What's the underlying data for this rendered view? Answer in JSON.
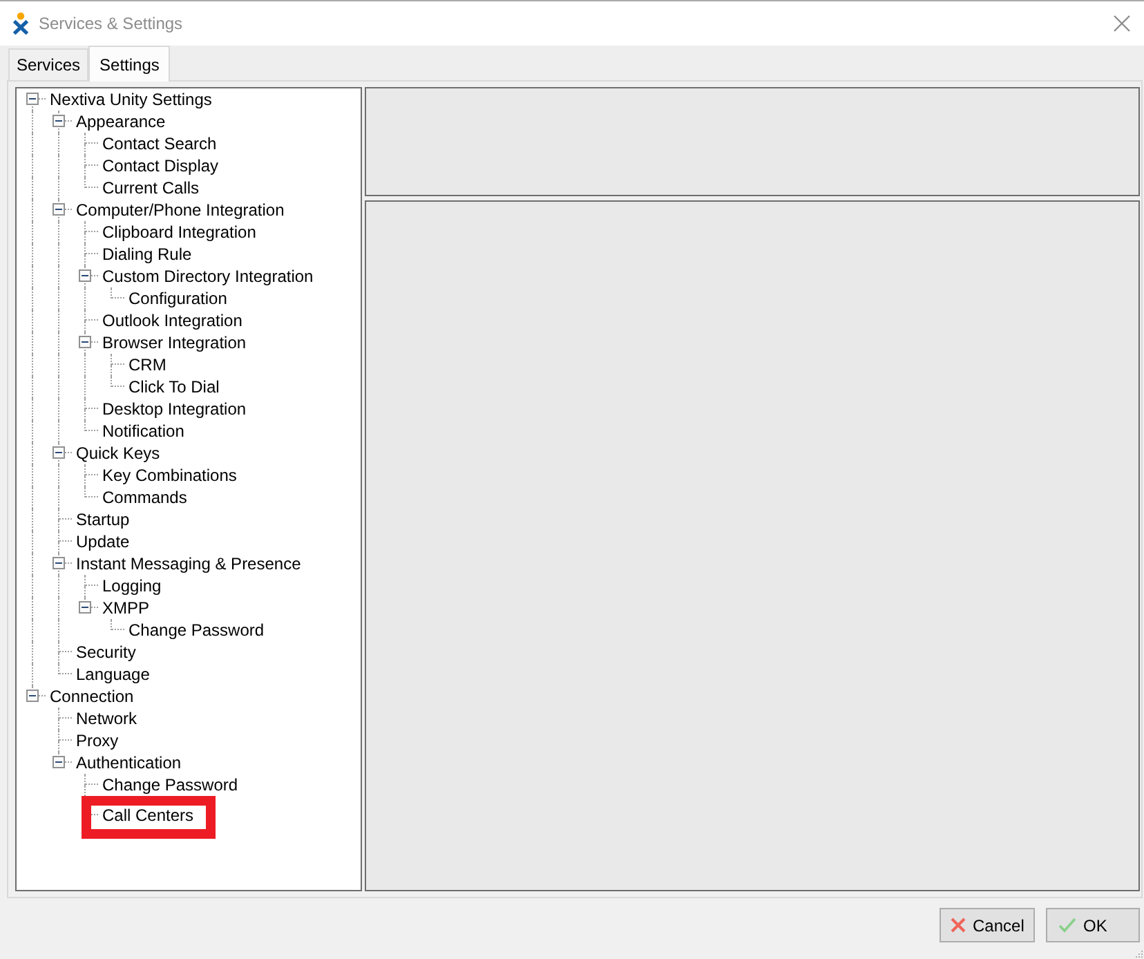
{
  "window": {
    "title": "Services & Settings"
  },
  "tabs": [
    {
      "label": "Services",
      "selected": false
    },
    {
      "label": "Settings",
      "selected": true
    }
  ],
  "settings_tree": [
    {
      "label": "Nextiva Unity Settings",
      "expanded": true,
      "highlighted": false,
      "children": [
        {
          "label": "Appearance",
          "expanded": true,
          "highlighted": false,
          "children": [
            {
              "label": "Contact Search",
              "highlighted": false
            },
            {
              "label": "Contact Display",
              "highlighted": false
            },
            {
              "label": "Current Calls",
              "highlighted": false
            }
          ]
        },
        {
          "label": "Computer/Phone Integration",
          "expanded": true,
          "highlighted": false,
          "children": [
            {
              "label": "Clipboard Integration",
              "highlighted": false
            },
            {
              "label": "Dialing Rule",
              "highlighted": false
            },
            {
              "label": "Custom Directory Integration",
              "expanded": true,
              "highlighted": false,
              "children": [
                {
                  "label": "Configuration",
                  "highlighted": false
                }
              ]
            },
            {
              "label": "Outlook Integration",
              "highlighted": false
            },
            {
              "label": "Browser Integration",
              "expanded": true,
              "highlighted": false,
              "children": [
                {
                  "label": "CRM",
                  "highlighted": false
                },
                {
                  "label": "Click To Dial",
                  "highlighted": false
                }
              ]
            },
            {
              "label": "Desktop Integration",
              "highlighted": false
            },
            {
              "label": "Notification",
              "highlighted": false
            }
          ]
        },
        {
          "label": "Quick Keys",
          "expanded": true,
          "highlighted": false,
          "children": [
            {
              "label": "Key Combinations",
              "highlighted": false
            },
            {
              "label": "Commands",
              "highlighted": false
            }
          ]
        },
        {
          "label": "Startup",
          "highlighted": false
        },
        {
          "label": "Update",
          "highlighted": false
        },
        {
          "label": "Instant Messaging & Presence",
          "expanded": true,
          "highlighted": false,
          "children": [
            {
              "label": "Logging",
              "highlighted": false
            },
            {
              "label": "XMPP",
              "expanded": true,
              "highlighted": false,
              "children": [
                {
                  "label": "Change Password",
                  "highlighted": false
                }
              ]
            }
          ]
        },
        {
          "label": "Security",
          "highlighted": false
        },
        {
          "label": "Language",
          "highlighted": false
        }
      ]
    },
    {
      "label": "Connection",
      "expanded": true,
      "highlighted": false,
      "children": [
        {
          "label": "Network",
          "highlighted": false
        },
        {
          "label": "Proxy",
          "highlighted": false
        },
        {
          "label": "Authentication",
          "expanded": true,
          "highlighted": false,
          "children": [
            {
              "label": "Change Password",
              "highlighted": false
            },
            {
              "label": "Call Centers",
              "highlighted": true
            }
          ]
        }
      ]
    }
  ],
  "buttons": [
    {
      "kind": "cancel",
      "label": "Cancel"
    },
    {
      "kind": "ok",
      "label": "OK"
    }
  ]
}
